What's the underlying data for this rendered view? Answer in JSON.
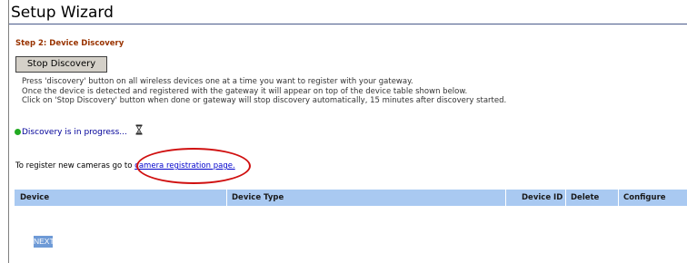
{
  "window": {
    "title": "Setup Wizard"
  },
  "step": {
    "label": "Step 2: Device Discovery"
  },
  "stop_button": {
    "label": "Stop Discovery"
  },
  "instructions": [
    "Press 'discovery' button on all wireless devices one at a time you want to register with your gateway.",
    "Once the device is detected and registered with the gateway it will appear on top of the device table shown below.",
    "Click on 'Stop Discovery' button when done or gateway will stop discovery automatically, 15 minutes after discovery started."
  ],
  "status": {
    "text": "Discovery is in progress...",
    "indicator_color": "#22aa22",
    "icon": "hourglass-icon"
  },
  "register": {
    "prefix": "To register new cameras go to ",
    "link_text": "camera registration page."
  },
  "annotation": {
    "color": "#d01010"
  },
  "table": {
    "header_color": "#a9c9f1",
    "columns": [
      "Device",
      "Device Type",
      "Device ID",
      "Delete",
      "Configure"
    ]
  },
  "next_button": {
    "label": "NEXT"
  }
}
